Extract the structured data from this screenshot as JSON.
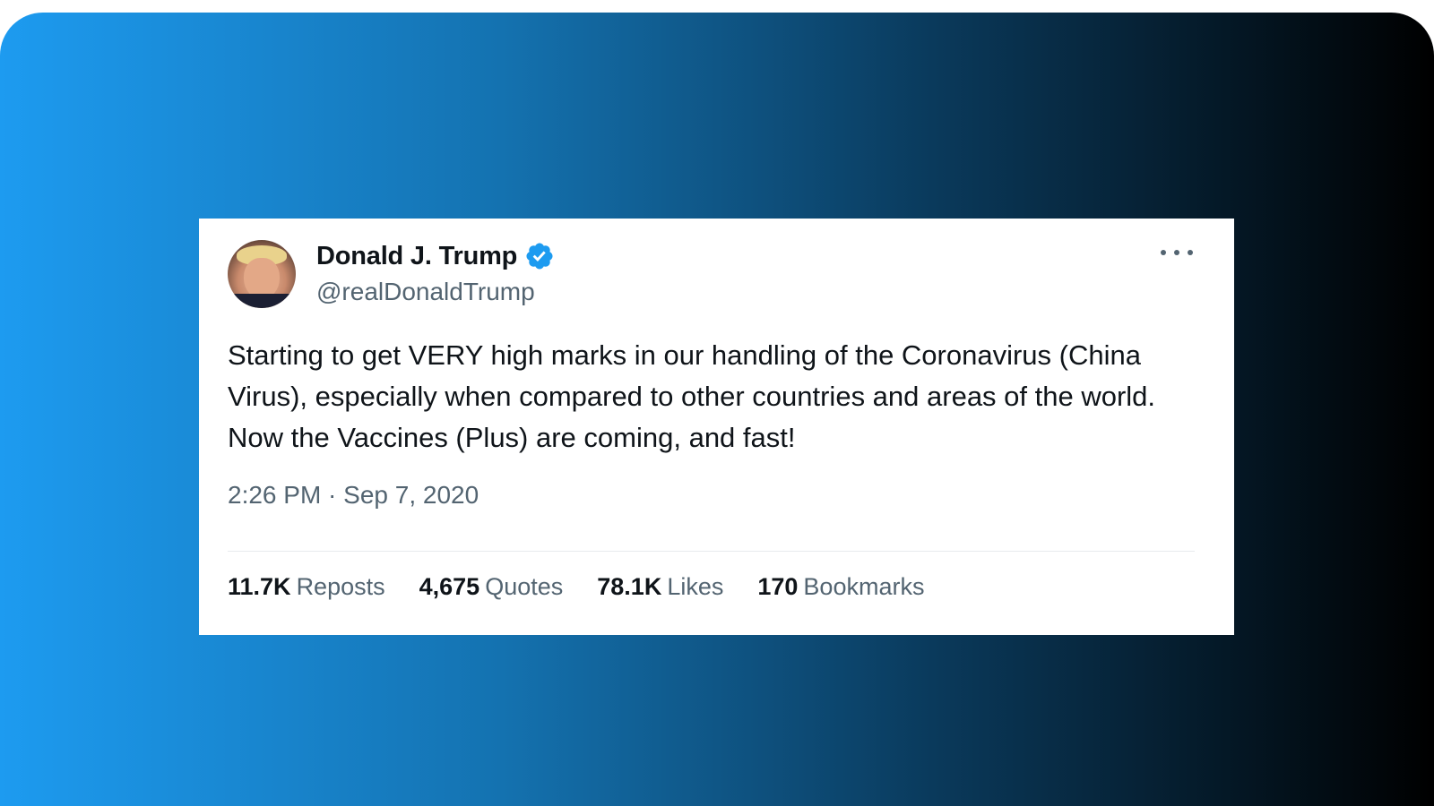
{
  "tweet": {
    "author_name": "Donald J. Trump",
    "handle": "@realDonaldTrump",
    "verified_icon": "verified-badge-icon",
    "text": "Starting to get VERY high marks in our handling of the Coronavirus (China Virus), especially when compared to other countries and areas of the world. Now the Vaccines (Plus) are coming, and fast!",
    "timestamp": "2:26 PM · Sep 7, 2020",
    "stats": [
      {
        "count": "11.7K",
        "label": "Reposts"
      },
      {
        "count": "4,675",
        "label": "Quotes"
      },
      {
        "count": "78.1K",
        "label": "Likes"
      },
      {
        "count": "170",
        "label": "Bookmarks"
      }
    ]
  },
  "colors": {
    "verified_blue": "#1d9bf0",
    "gradient_start": "#1d9bf0",
    "gradient_end": "#000000",
    "text_primary": "#0f1419",
    "text_secondary": "#536471"
  }
}
